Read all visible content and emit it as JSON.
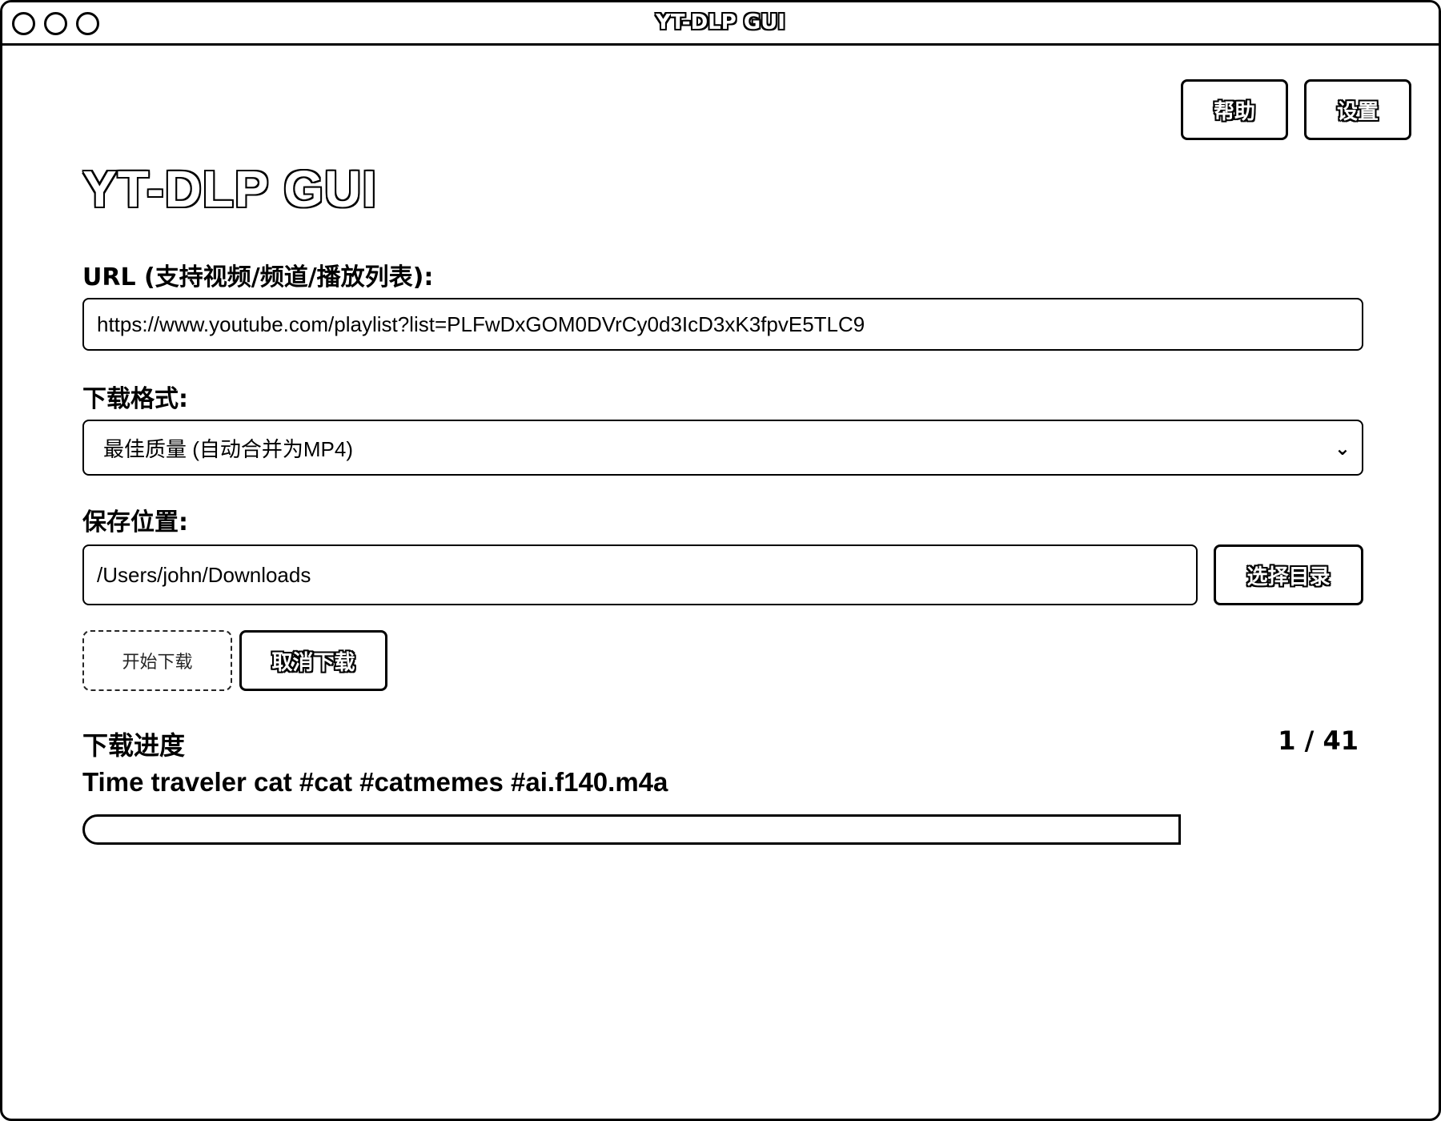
{
  "window": {
    "title": "YT-DLP GUI"
  },
  "header": {
    "help_label": "帮助",
    "settings_label": "设置"
  },
  "app_title": "YT-DLP GUI",
  "url_section": {
    "label": "URL (支持视频/频道/播放列表):",
    "value": "https://www.youtube.com/playlist?list=PLFwDxGOM0DVrCy0d3IcD3xK3fpvE5TLC9"
  },
  "format_section": {
    "label": "下载格式:",
    "selected": "最佳质量 (自动合并为MP4)"
  },
  "save_section": {
    "label": "保存位置:",
    "path": "/Users/john/Downloads",
    "choose_label": "选择目录"
  },
  "actions": {
    "start_label": "开始下载",
    "cancel_label": "取消下载"
  },
  "progress": {
    "label": "下载进度",
    "count": "1 / 41",
    "current_file": "Time traveler cat #cat #catmemes #ai.f140.m4a",
    "fraction": 0.0
  },
  "icons": {
    "select_chevron": "chevron-down-icon"
  }
}
